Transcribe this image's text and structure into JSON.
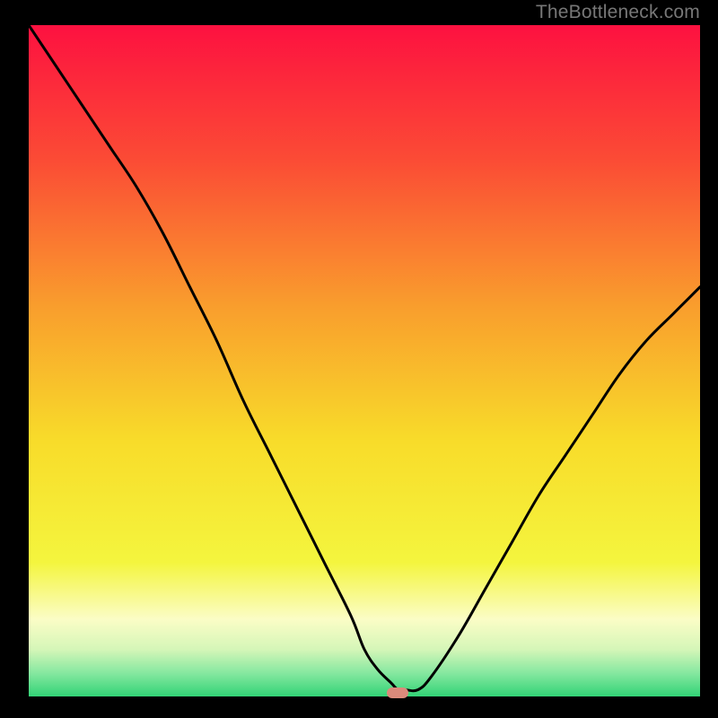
{
  "watermark": "TheBottleneck.com",
  "chart_data": {
    "type": "line",
    "title": "",
    "xlabel": "",
    "ylabel": "",
    "xlim": [
      0,
      100
    ],
    "ylim": [
      0,
      100
    ],
    "grid": false,
    "legend": false,
    "background_gradient_stops": [
      {
        "offset": 0,
        "color": "#fd1140"
      },
      {
        "offset": 0.2,
        "color": "#fb4b35"
      },
      {
        "offset": 0.42,
        "color": "#f99e2d"
      },
      {
        "offset": 0.62,
        "color": "#f8dc2a"
      },
      {
        "offset": 0.8,
        "color": "#f4f53e"
      },
      {
        "offset": 0.885,
        "color": "#fbfdc6"
      },
      {
        "offset": 0.93,
        "color": "#d5f6b8"
      },
      {
        "offset": 0.965,
        "color": "#86e8a0"
      },
      {
        "offset": 1.0,
        "color": "#32d376"
      }
    ],
    "series": [
      {
        "name": "bottleneck-curve",
        "color": "#000000",
        "x": [
          0,
          4,
          8,
          12,
          16,
          20,
          24,
          28,
          32,
          36,
          40,
          44,
          48,
          50,
          52,
          54,
          55,
          56,
          58,
          60,
          64,
          68,
          72,
          76,
          80,
          84,
          88,
          92,
          96,
          100
        ],
        "y": [
          100,
          94,
          88,
          82,
          76,
          69,
          61,
          53,
          44,
          36,
          28,
          20,
          12,
          7,
          4,
          2,
          1,
          1,
          1,
          3,
          9,
          16,
          23,
          30,
          36,
          42,
          48,
          53,
          57,
          61
        ]
      }
    ],
    "optimum_marker": {
      "x": 55,
      "y": 0.5,
      "color": "#db8a7b"
    }
  }
}
